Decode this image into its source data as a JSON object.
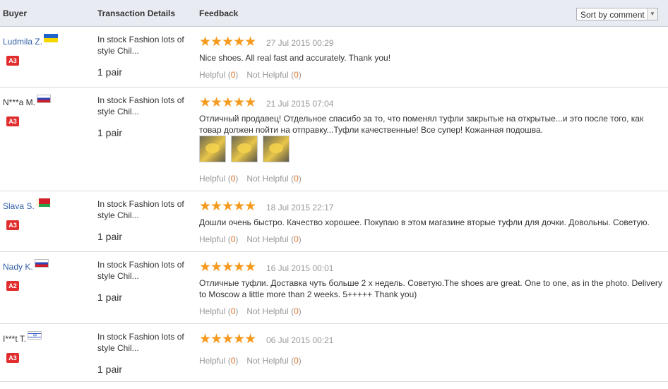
{
  "header": {
    "buyer_col": "Buyer",
    "transaction_col": "Transaction Details",
    "feedback_col": "Feedback",
    "sort_label": "Sort by comment"
  },
  "stars_glyph": "★★★★★",
  "helpful_label": "Helpful",
  "not_helpful_label": "Not Helpful",
  "rows": [
    {
      "buyer": "Ludmila Z.",
      "flag": "ukraine",
      "badge": "A3",
      "transaction": "In stock Fashion lots of style Chil...",
      "quantity": "1 pair",
      "date": "27 Jul 2015 00:29",
      "text": "Nice shoes. All real fast and accurately. Thank you!",
      "helpful": "0",
      "not_helpful": "0"
    },
    {
      "buyer": "N***a M.",
      "flag": "russia",
      "badge": "A3",
      "transaction": "In stock Fashion lots of style Chil...",
      "quantity": "1 pair",
      "date": "21 Jul 2015 07:04",
      "text": "Отличный продавец! Отдельное спасибо за то, что поменял туфли закрытые на открытые...и это после того, как товар должен пойти на отправку...Туфли качественные! Все супер! Кожанная подошва.",
      "helpful": "0",
      "not_helpful": "0"
    },
    {
      "buyer": "Slava S.",
      "flag": "belarus",
      "badge": "A3",
      "transaction": "In stock Fashion lots of style Chil...",
      "quantity": "1 pair",
      "date": "18 Jul 2015 22:17",
      "text": "Дошли очень быстро. Качество хорошее. Покупаю в этом магазине вторые туфли для дочки. Довольны. Советую.",
      "helpful": "0",
      "not_helpful": "0"
    },
    {
      "buyer": "Nady K.",
      "flag": "russia",
      "badge": "A2",
      "transaction": "In stock Fashion lots of style Chil...",
      "quantity": "1 pair",
      "date": "16 Jul 2015 00:01",
      "text": "Отличные туфли. Доставка чуть больше 2 х недель. Советую.The shoes are great. One to one, as in the photo. Delivery to Moscow a little more than 2 weeks. 5+++++ Thank you)",
      "helpful": "0",
      "not_helpful": "0"
    },
    {
      "buyer": "I***t T.",
      "flag": "israel",
      "badge": "A3",
      "transaction": "In stock Fashion lots of style Chil...",
      "quantity": "1 pair",
      "date": "06 Jul 2015 00:21",
      "text": "",
      "helpful": "0",
      "not_helpful": "0"
    }
  ]
}
